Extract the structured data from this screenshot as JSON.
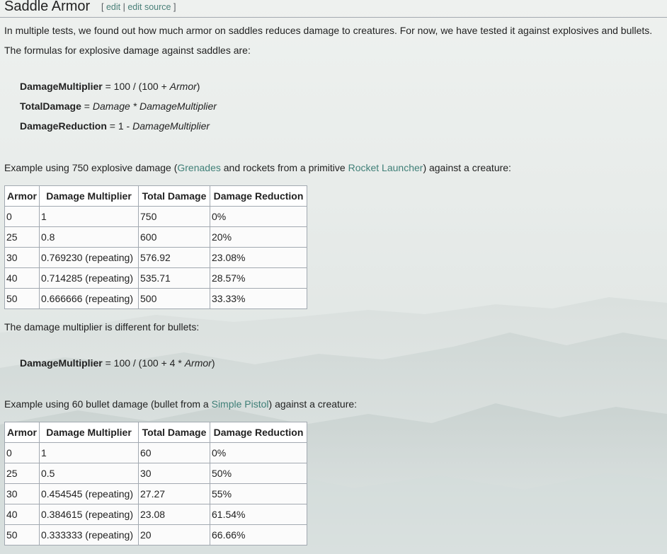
{
  "heading": {
    "title": "Saddle Armor",
    "bracket_open": "[",
    "edit": "edit",
    "sep": "|",
    "edit_source": "edit source",
    "bracket_close": "]"
  },
  "intro": "In multiple tests, we found out how much armor on saddles reduces damage to creatures. For now, we have tested it against explosives and bullets.",
  "explosive_formulas_intro": "The formulas for explosive damage against saddles are:",
  "formulas": {
    "f1": {
      "name": "DamageMultiplier",
      "eq": " = 100 / (100 + ",
      "var": "Armor",
      "end": ")"
    },
    "f2": {
      "name": "TotalDamage",
      "eq": " = ",
      "var1": "Damage",
      "op": " * ",
      "var2": "DamageMultiplier"
    },
    "f3": {
      "name": "DamageReduction",
      "eq": " = 1 - ",
      "var": "DamageMultiplier"
    }
  },
  "explosive_example": {
    "before": "Example using 750 explosive damage (",
    "link1": "Grenades",
    "middle": " and rockets from a primitive ",
    "link2": "Rocket Launcher",
    "after": ") against a creature:"
  },
  "table_headers": [
    "Armor",
    "Damage Multiplier",
    "Total Damage",
    "Damage Reduction"
  ],
  "explosive_table": [
    [
      "0",
      "1",
      "750",
      "0%"
    ],
    [
      "25",
      "0.8",
      "600",
      "20%"
    ],
    [
      "30",
      "0.769230 (repeating)",
      "576.92",
      "23.08%"
    ],
    [
      "40",
      "0.714285 (repeating)",
      "535.71",
      "28.57%"
    ],
    [
      "50",
      "0.666666 (repeating)",
      "500",
      "33.33%"
    ]
  ],
  "bullet_intro": "The damage multiplier is different for bullets:",
  "bullet_formula": {
    "name": "DamageMultiplier",
    "eq": " = 100 / (100 + 4 * ",
    "var": "Armor",
    "end": ")"
  },
  "bullet_example": {
    "before": "Example using 60 bullet damage (bullet from a ",
    "link": "Simple Pistol",
    "after": ") against a creature:"
  },
  "bullet_table": [
    [
      "0",
      "1",
      "60",
      "0%"
    ],
    [
      "25",
      "0.5",
      "30",
      "50%"
    ],
    [
      "30",
      "0.454545 (repeating)",
      "27.27",
      "55%"
    ],
    [
      "40",
      "0.384615 (repeating)",
      "23.08",
      "61.54%"
    ],
    [
      "50",
      "0.333333 (repeating)",
      "20",
      "66.66%"
    ]
  ],
  "colors": {
    "link": "#3f7f77",
    "border": "#a2a9b1",
    "text": "#222222"
  }
}
